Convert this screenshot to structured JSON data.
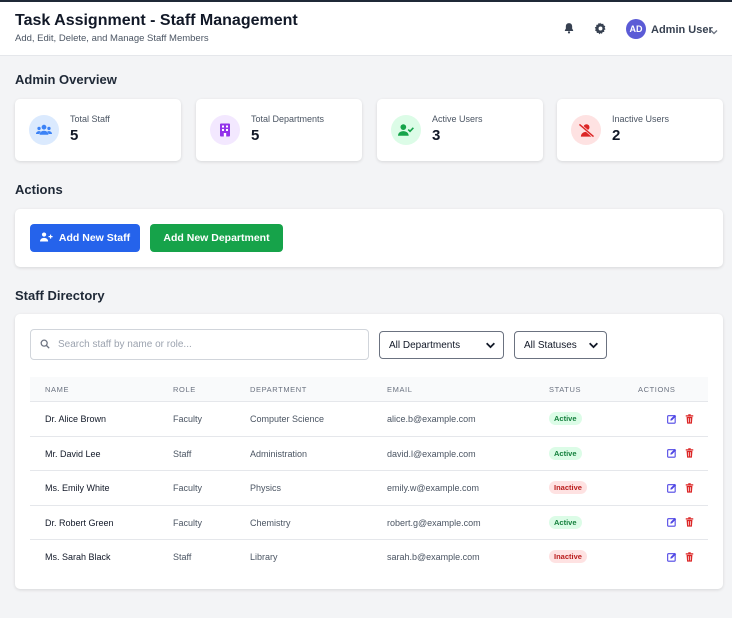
{
  "header": {
    "title": "Task Assignment - Staff Management",
    "subtitle": "Add, Edit, Delete, and Manage Staff Members",
    "user_initials": "AD",
    "user_name": "Admin User"
  },
  "overview": {
    "title": "Admin Overview",
    "cards": [
      {
        "label": "Total Staff",
        "value": "5",
        "icon": "users-icon",
        "color": "#3b82f6",
        "bg": "#dbeafe"
      },
      {
        "label": "Total Departments",
        "value": "5",
        "icon": "building-icon",
        "color": "#9333ea",
        "bg": "#f3e8ff"
      },
      {
        "label": "Active Users",
        "value": "3",
        "icon": "user-check-icon",
        "color": "#16a34a",
        "bg": "#dcfce7"
      },
      {
        "label": "Inactive Users",
        "value": "2",
        "icon": "user-slash-icon",
        "color": "#dc2626",
        "bg": "#fee2e2"
      }
    ]
  },
  "actions": {
    "title": "Actions",
    "add_staff_label": "Add New Staff",
    "add_department_label": "Add New Department"
  },
  "directory": {
    "title": "Staff Directory",
    "search_placeholder": "Search staff by name or role...",
    "department_filter": "All Departments",
    "status_filter": "All Statuses",
    "columns": [
      "NAME",
      "ROLE",
      "DEPARTMENT",
      "EMAIL",
      "STATUS",
      "ACTIONS"
    ],
    "rows": [
      {
        "name": "Dr. Alice Brown",
        "role": "Faculty",
        "department": "Computer Science",
        "email": "alice.b@example.com",
        "status": "Active"
      },
      {
        "name": "Mr. David Lee",
        "role": "Staff",
        "department": "Administration",
        "email": "david.l@example.com",
        "status": "Active"
      },
      {
        "name": "Ms. Emily White",
        "role": "Faculty",
        "department": "Physics",
        "email": "emily.w@example.com",
        "status": "Inactive"
      },
      {
        "name": "Dr. Robert Green",
        "role": "Faculty",
        "department": "Chemistry",
        "email": "robert.g@example.com",
        "status": "Active"
      },
      {
        "name": "Ms. Sarah Black",
        "role": "Staff",
        "department": "Library",
        "email": "sarah.b@example.com",
        "status": "Inactive"
      }
    ]
  },
  "colors": {
    "primary": "#2563eb",
    "success": "#16a34a",
    "danger": "#dc2626",
    "edit": "#4f46e5"
  }
}
